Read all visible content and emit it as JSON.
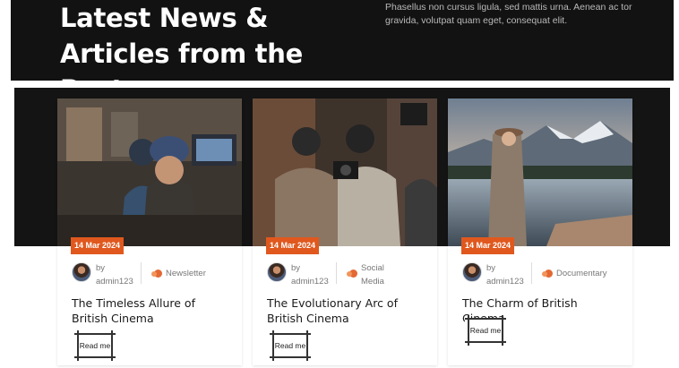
{
  "header": {
    "title": "Latest News & Articles from the Posts",
    "description": "Phasellus non cursus ligula, sed mattis urna. Aenean ac tor gravida, volutpat quam eget, consequat elit."
  },
  "cards": [
    {
      "date": "14 Mar 2024",
      "author_prefix": "by",
      "author": "admin123",
      "category": "Newsletter",
      "title": "The Timeless Allure of British Cinema",
      "read_more": "Read me",
      "image_icon": "film-crew-photo"
    },
    {
      "date": "14 Mar 2024",
      "author_prefix": "by",
      "author": "admin123",
      "category": "Social Media",
      "title": "The Evolutionary Arc of British Cinema",
      "read_more": "Read me",
      "image_icon": "camera-operators-photo"
    },
    {
      "date": "14 Mar 2024",
      "author_prefix": "by",
      "author": "admin123",
      "category": "Documentary",
      "title": "The Charm of British Cinema",
      "read_more": "Read me",
      "image_icon": "mountain-lake-photo"
    }
  ],
  "colors": {
    "accent": "#e0581e",
    "dark": "#121212"
  }
}
